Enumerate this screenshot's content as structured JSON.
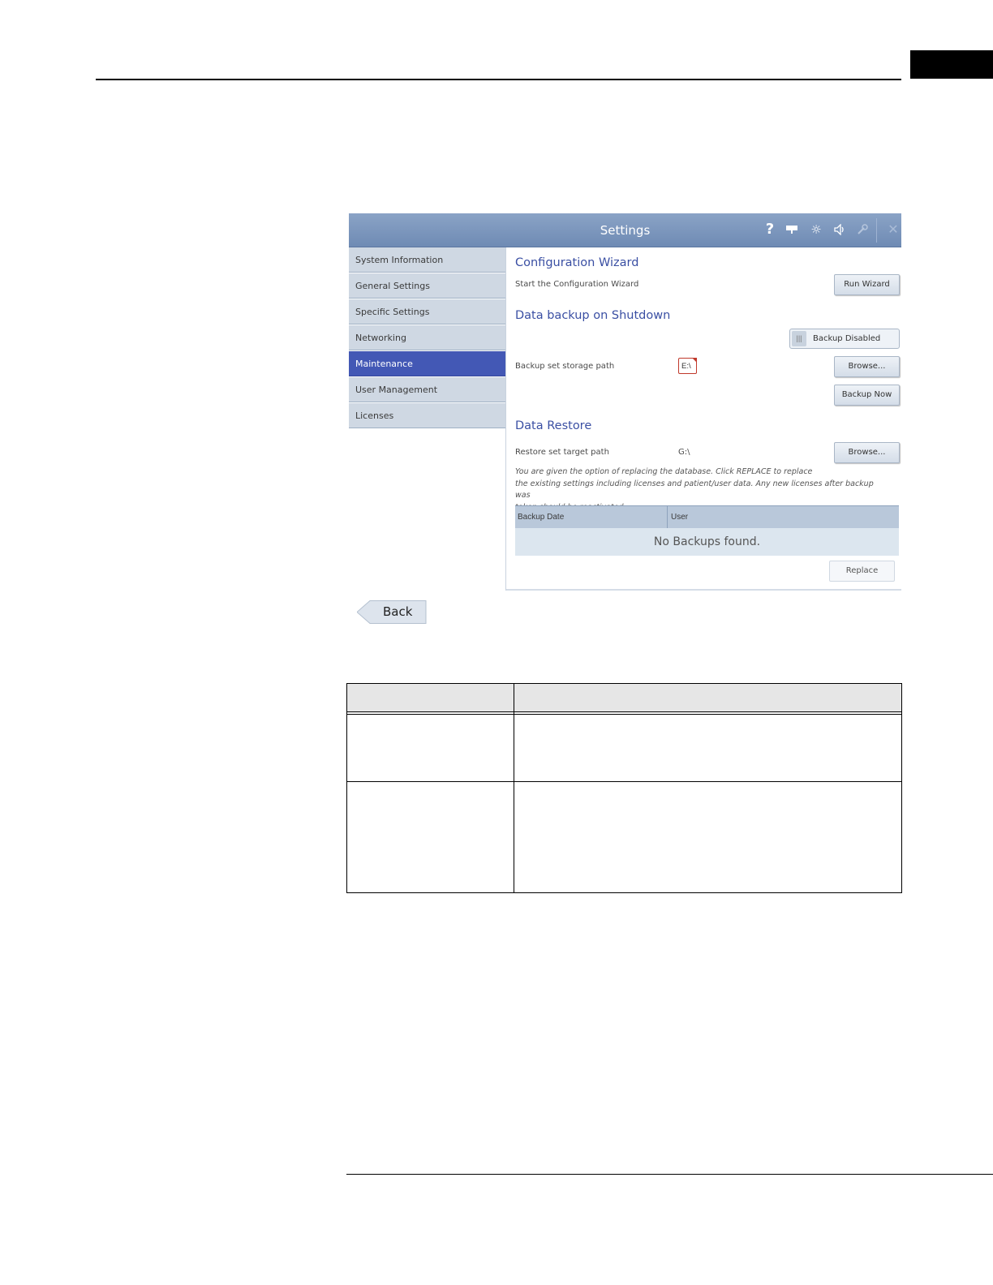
{
  "window": {
    "title": "Settings",
    "toolbar_icons": [
      "help-icon",
      "display-icon",
      "brightness-icon",
      "volume-icon",
      "wrench-icon",
      "close-icon"
    ]
  },
  "sidebar": {
    "items": [
      {
        "label": "System Information"
      },
      {
        "label": "General Settings"
      },
      {
        "label": "Specific Settings"
      },
      {
        "label": "Networking"
      },
      {
        "label": "Maintenance",
        "active": true
      },
      {
        "label": "User Management"
      },
      {
        "label": "Licenses"
      }
    ]
  },
  "config_wizard": {
    "heading": "Configuration Wizard",
    "description": "Start the Configuration Wizard",
    "button": "Run Wizard"
  },
  "backup": {
    "heading": "Data backup on Shutdown",
    "toggle_label": "Backup Disabled",
    "path_label": "Backup set storage path",
    "path_value": "E:\\",
    "browse_button": "Browse...",
    "backup_now_button": "Backup Now"
  },
  "restore": {
    "heading": "Data Restore",
    "path_label": "Restore set target path",
    "path_value": "G:\\",
    "browse_button": "Browse...",
    "note_line1": "You are given the option of replacing the database. Click REPLACE to replace",
    "note_line2": "the existing settings including licenses and patient/user data. Any new licenses after backup was",
    "note_line3": "taken should be reactivated.",
    "table": {
      "columns": [
        "Backup Date",
        "User"
      ],
      "empty_message": "No Backups found."
    },
    "replace_button": "Replace"
  },
  "back_button": "Back",
  "colors": {
    "accent": "#4358b5",
    "heading": "#3a4fa3",
    "titlebar": "#7b95bd"
  }
}
